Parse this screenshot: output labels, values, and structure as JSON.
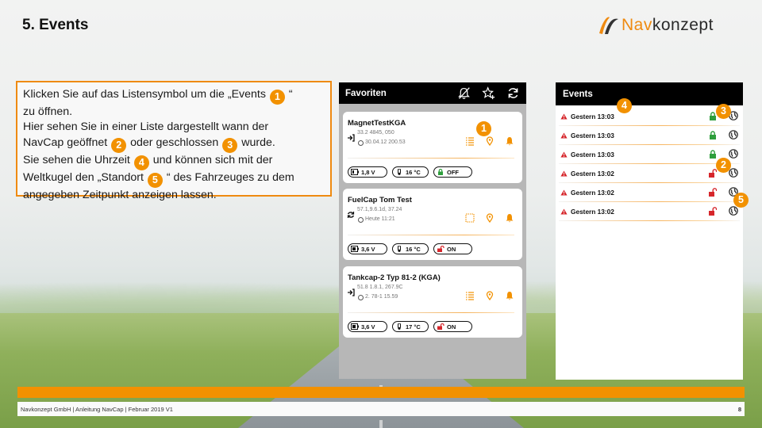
{
  "slide": {
    "title": "5. Events",
    "page_number": "8"
  },
  "logo": {
    "part1": "Nav",
    "part2": "konzept"
  },
  "instructions": {
    "l1a": "Klicken Sie auf das Listensymbol um die „Events ",
    "l1b": " “",
    "l2": "zu öffnen.",
    "l3": "Hier sehen Sie in einer Liste dargestellt wann der",
    "l4a": "NavCap geöffnet ",
    "l4b": " oder geschlossen ",
    "l4c": " wurde.",
    "l5a": "Sie sehen die Uhrzeit ",
    "l5b": " und können sich mit der",
    "l6a": "Weltkugel den „Standort ",
    "l6b": " “ des Fahrzeuges zu dem",
    "l7": "angegeben Zeitpunkt anzeigen lassen.",
    "badges": [
      "1",
      "2",
      "3",
      "4",
      "5"
    ]
  },
  "favorites": {
    "title": "Favoriten",
    "header_icons": [
      "bell-off-icon",
      "star-add-icon",
      "refresh-icon"
    ],
    "cards": [
      {
        "name": "MagnetTestKGA",
        "line1": "33.2  4845, 050",
        "line2": "30.04.12  200.53",
        "battery": "1,8 V",
        "temp": "16 °C",
        "lock": "OFF",
        "lock_state": "locked"
      },
      {
        "name": "FuelCap Tom Test",
        "line1": "57.1,9.6.1d, 37.24",
        "line2": "Heute 11:21",
        "battery": "3,6 V",
        "temp": "16 °C",
        "lock": "ON",
        "lock_state": "unlocked"
      },
      {
        "name": "Tankcap-2 Typ 81-2 (KGA)",
        "line1": "51.8 1.8.1, 267.9C",
        "line2": "2. 78-1  15.59",
        "battery": "3,6 V",
        "temp": "17 °C",
        "lock": "ON",
        "lock_state": "unlocked"
      }
    ]
  },
  "events": {
    "title": "Events",
    "rows": [
      {
        "time": "Gestern 13:03",
        "lock_state": "locked"
      },
      {
        "time": "Gestern 13:03",
        "lock_state": "locked"
      },
      {
        "time": "Gestern 13:03",
        "lock_state": "locked"
      },
      {
        "time": "Gestern 13:02",
        "lock_state": "unlocked"
      },
      {
        "time": "Gestern 13:02",
        "lock_state": "unlocked"
      },
      {
        "time": "Gestern 13:02",
        "lock_state": "unlocked"
      }
    ]
  },
  "footer": {
    "text": "Navkonzept GmbH  |  Anleitung NavCap  | Februar 2019 V1"
  },
  "colors": {
    "accent": "#f29100",
    "locked": "#2e9e3c",
    "unlocked": "#d6262b",
    "header": "#000000"
  }
}
